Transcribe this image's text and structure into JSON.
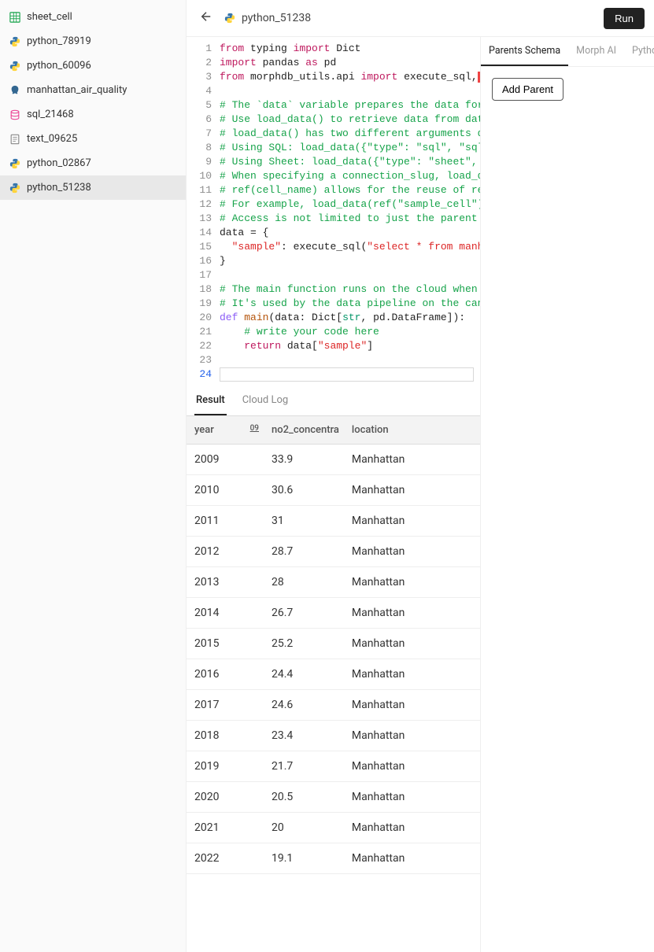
{
  "sidebar": {
    "items": [
      {
        "label": "sheet_cell",
        "icon": "sheet"
      },
      {
        "label": "python_78919",
        "icon": "python"
      },
      {
        "label": "python_60096",
        "icon": "python"
      },
      {
        "label": "manhattan_air_quality",
        "icon": "postgres"
      },
      {
        "label": "sql_21468",
        "icon": "sql"
      },
      {
        "label": "text_09625",
        "icon": "text"
      },
      {
        "label": "python_02867",
        "icon": "python"
      },
      {
        "label": "python_51238",
        "icon": "python",
        "active": true
      }
    ]
  },
  "header": {
    "title": "python_51238",
    "run_label": "Run"
  },
  "editor": {
    "current_line": 24,
    "lines_html": [
      "<span class='tk-op'>from</span> typing <span class='tk-op'>import</span> Dict",
      "<span class='tk-op'>import</span> pandas <span class='tk-op'>as</span> pd",
      "<span class='tk-op'>from</span> morphdb_utils.api <span class='tk-op'>import</span> execute_sql,<span class='error-sq'></span>",
      "",
      "<span class='tk-com'># The `data` variable prepares the data for</span>",
      "<span class='tk-com'># Use load_data() to retrieve data from dat</span>",
      "<span class='tk-com'># load_data() has two different arguments d</span>",
      "<span class='tk-com'># Using SQL: load_data({\"type\": \"sql\", \"sql</span>",
      "<span class='tk-com'># Using Sheet: load_data({\"type\": \"sheet\",</span>",
      "<span class='tk-com'># When specifying a connection_slug, load_d</span>",
      "<span class='tk-com'># ref(cell_name) allows for the reuse of re</span>",
      "<span class='tk-com'># For example, load_data(ref(\"sample_cell\")</span>",
      "<span class='tk-com'># Access is not limited to just the parent</span>",
      "data = {",
      "  <span class='tk-str'>\"sample\"</span>: execute_sql(<span class='tk-str'>\"select * from manh</span>",
      "}",
      "",
      "<span class='tk-com'># The main function runs on the cloud when</span>",
      "<span class='tk-com'># It's used by the data pipeline on the can</span>",
      "<span class='tk-kw'>def</span> <span class='tk-fn'>main</span>(data: Dict[<span class='tk-builtin'>str</span>, pd.DataFrame]):",
      "    <span class='tk-com'># write your code here</span>",
      "    <span class='tk-op'>return</span> data[<span class='tk-str'>\"sample\"</span>]",
      "",
      ""
    ]
  },
  "output_tabs": {
    "items": [
      {
        "label": "Result",
        "active": true
      },
      {
        "label": "Cloud Log"
      }
    ]
  },
  "table": {
    "headers": [
      "year",
      "no2_concentra",
      "location"
    ],
    "sort_indicator": "09",
    "rows": [
      {
        "year": "2009",
        "no2": "33.9",
        "location": "Manhattan"
      },
      {
        "year": "2010",
        "no2": "30.6",
        "location": "Manhattan"
      },
      {
        "year": "2011",
        "no2": "31",
        "location": "Manhattan"
      },
      {
        "year": "2012",
        "no2": "28.7",
        "location": "Manhattan"
      },
      {
        "year": "2013",
        "no2": "28",
        "location": "Manhattan"
      },
      {
        "year": "2014",
        "no2": "26.7",
        "location": "Manhattan"
      },
      {
        "year": "2015",
        "no2": "25.2",
        "location": "Manhattan"
      },
      {
        "year": "2016",
        "no2": "24.4",
        "location": "Manhattan"
      },
      {
        "year": "2017",
        "no2": "24.6",
        "location": "Manhattan"
      },
      {
        "year": "2018",
        "no2": "23.4",
        "location": "Manhattan"
      },
      {
        "year": "2019",
        "no2": "21.7",
        "location": "Manhattan"
      },
      {
        "year": "2020",
        "no2": "20.5",
        "location": "Manhattan"
      },
      {
        "year": "2021",
        "no2": "20",
        "location": "Manhattan"
      },
      {
        "year": "2022",
        "no2": "19.1",
        "location": "Manhattan"
      }
    ]
  },
  "right_panel": {
    "tabs": [
      {
        "label": "Parents Schema",
        "active": true
      },
      {
        "label": "Morph AI"
      },
      {
        "label": "Python In"
      }
    ],
    "add_parent_label": "Add Parent"
  }
}
